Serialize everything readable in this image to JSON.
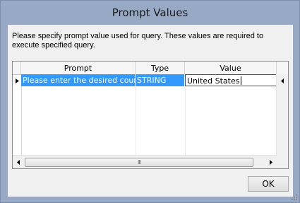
{
  "window": {
    "title": "Prompt Values"
  },
  "instructions": "Please specify prompt value used for query.  These values are required to execute specified query.",
  "grid": {
    "columns": [
      "Prompt",
      "Type",
      "Value"
    ],
    "rows": [
      {
        "prompt": "Please enter the desired country",
        "type": "STRING",
        "value": "United States"
      }
    ],
    "hscroll_grip": "III"
  },
  "buttons": {
    "ok_label": "OK"
  },
  "icons": {
    "row_indicator": "triangle-right",
    "scroll_left": "triangle-left",
    "scroll_right": "triangle-right",
    "resize_grip": "dots"
  },
  "colors": {
    "titlebar": "#97a9c5",
    "selection": "#3399ff"
  }
}
